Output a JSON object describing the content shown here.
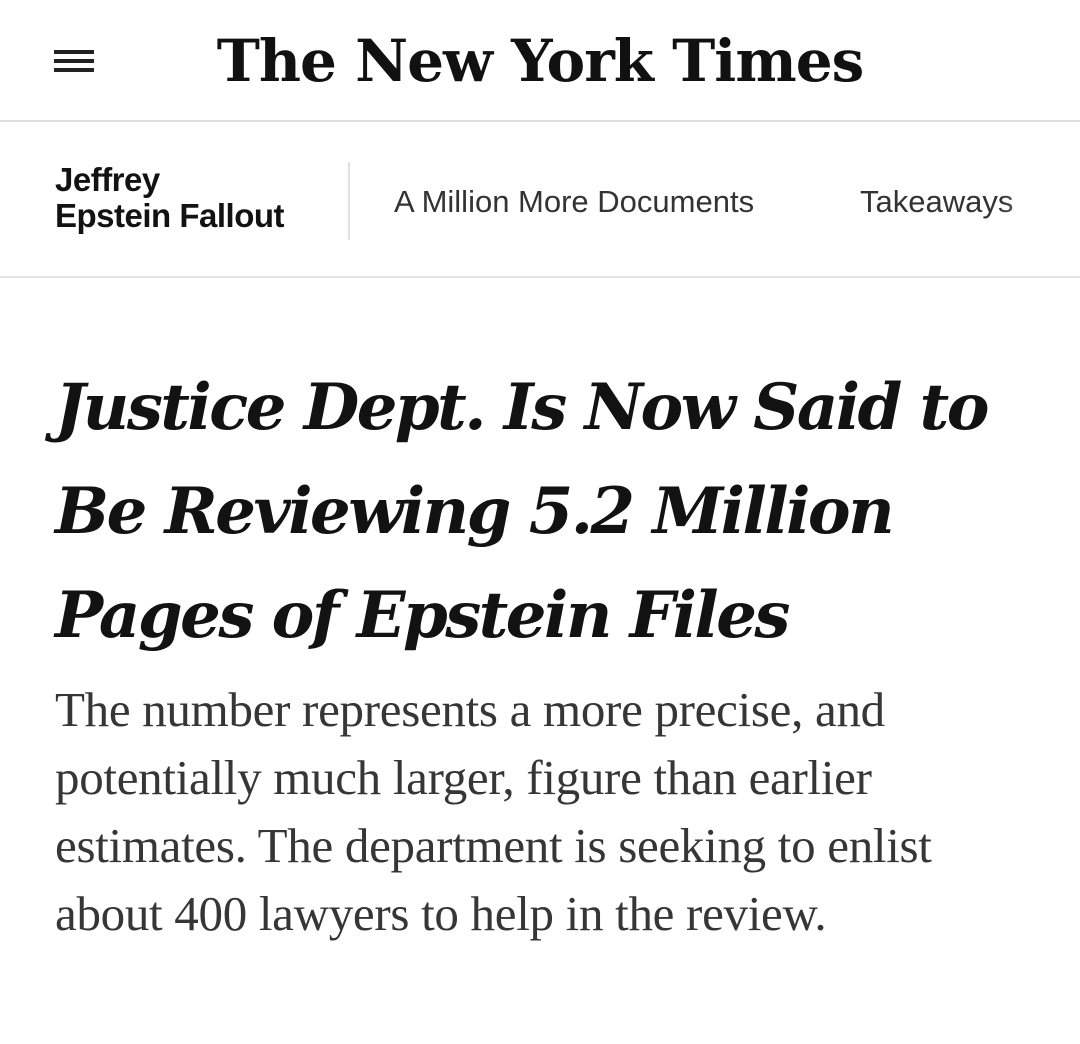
{
  "masthead": {
    "logo": "The New York Times",
    "menu_icon": "hamburger-menu-icon"
  },
  "section_nav": {
    "title_line1": "Jeffrey",
    "title_line2": "Epstein Fallout",
    "links": [
      "A Million More Documents",
      "Takeaways"
    ]
  },
  "article": {
    "headline": "Justice Dept. Is Now Said to Be Reviewing 5.2 Million Pages of Epstein Files",
    "summary": "The number represents a more precise, and potentially much larger, figure than earlier estimates. The department is seeking to enlist about 400 lawyers to help in the review."
  },
  "colors": {
    "text": "#121212",
    "summary_text": "#363636",
    "divider": "#dfdfdf"
  }
}
